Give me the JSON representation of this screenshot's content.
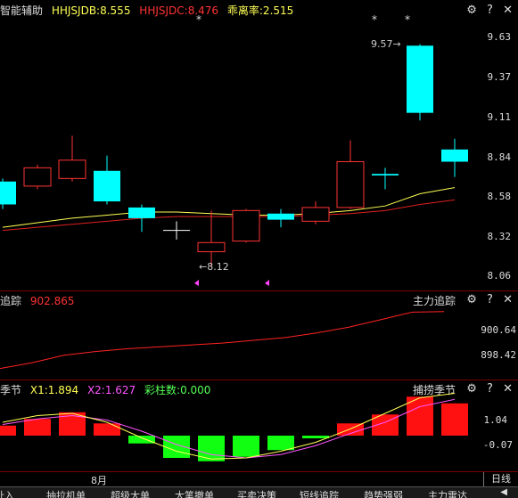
{
  "main_panel": {
    "legend": [
      {
        "text": "智能辅助",
        "color": "#dddddd"
      },
      {
        "text": "HHJSJDB:8.555",
        "color": "#ffff55"
      },
      {
        "text": "HHJSJDC:8.476",
        "color": "#ff3333"
      },
      {
        "text": "乖离率:2.515",
        "color": "#ffff55"
      }
    ],
    "y_labels": [
      "9.63",
      "9.37",
      "9.11",
      "8.84",
      "8.58",
      "8.32",
      "8.06"
    ],
    "high_annotation": "9.57→",
    "low_annotation": "←8.12"
  },
  "middle_panel": {
    "legend": [
      {
        "text": "追踪",
        "color": "#dddddd"
      },
      {
        "text": "902.865",
        "color": "#ff3333"
      }
    ],
    "title": "主力追踪",
    "y_labels": [
      "900.64",
      "898.42"
    ]
  },
  "bottom_panel": {
    "legend": [
      {
        "text": "季节",
        "color": "#dddddd"
      },
      {
        "text": "X1:1.894",
        "color": "#ffff55"
      },
      {
        "text": "X2:1.627",
        "color": "#ff55ff"
      },
      {
        "text": "彩柱数:0.000",
        "color": "#55ff55"
      }
    ],
    "title": "捕捞季节",
    "y_labels": [
      "1.04",
      "-0.07"
    ],
    "x_label": "8月"
  },
  "period_label": "日线",
  "tabs": [
    "扯入",
    "抽拉机单",
    "超级大单",
    "大笔撤单",
    "买卖决策",
    "短线追踪",
    "趋势强弱",
    "主力雷达"
  ],
  "chart_data": {
    "type": "candlestick",
    "ylim": [
      8.06,
      9.63
    ],
    "candles": [
      {
        "open": 8.68,
        "close": 8.53,
        "high": 8.7,
        "low": 8.5
      },
      {
        "open": 8.65,
        "close": 8.77,
        "high": 8.79,
        "low": 8.63
      },
      {
        "open": 8.7,
        "close": 8.82,
        "high": 8.98,
        "low": 8.68
      },
      {
        "open": 8.75,
        "close": 8.55,
        "high": 8.85,
        "low": 8.53
      },
      {
        "open": 8.51,
        "close": 8.44,
        "high": 8.53,
        "low": 8.35
      },
      {
        "open": 8.36,
        "close": 8.36,
        "high": 8.42,
        "low": 8.3
      },
      {
        "open": 8.22,
        "close": 8.28,
        "high": 8.49,
        "low": 8.12
      },
      {
        "open": 8.29,
        "close": 8.49,
        "high": 8.5,
        "low": 8.28
      },
      {
        "open": 8.47,
        "close": 8.43,
        "high": 8.5,
        "low": 8.38
      },
      {
        "open": 8.42,
        "close": 8.51,
        "high": 8.55,
        "low": 8.4
      },
      {
        "open": 8.51,
        "close": 8.81,
        "high": 8.95,
        "low": 8.5
      },
      {
        "open": 8.73,
        "close": 8.72,
        "high": 8.77,
        "low": 8.63
      },
      {
        "open": 9.57,
        "close": 9.13,
        "high": 9.58,
        "low": 9.08
      },
      {
        "open": 8.89,
        "close": 8.81,
        "high": 8.96,
        "low": 8.71
      }
    ],
    "ma_yellow": [
      8.38,
      8.41,
      8.44,
      8.46,
      8.48,
      8.48,
      8.47,
      8.46,
      8.46,
      8.47,
      8.49,
      8.52,
      8.6,
      8.64
    ],
    "ma_red": [
      8.36,
      8.38,
      8.4,
      8.42,
      8.44,
      8.45,
      8.45,
      8.45,
      8.45,
      8.46,
      8.47,
      8.49,
      8.53,
      8.56
    ],
    "markers_top": [
      "*",
      "*",
      "*"
    ],
    "tracking_line": [
      896.8,
      897.4,
      898.2,
      898.6,
      898.9,
      899.1,
      899.3,
      899.5,
      899.8,
      900.1,
      900.6,
      901.2,
      902.0,
      902.8,
      902.865
    ],
    "season_bars": [
      0.45,
      0.75,
      1.05,
      0.55,
      -0.35,
      -1.0,
      -1.15,
      -0.95,
      -0.65,
      -0.12,
      0.55,
      0.95,
      1.75,
      1.45
    ],
    "season_x1": [
      0.6,
      0.9,
      1.0,
      0.6,
      -0.1,
      -0.7,
      -1.05,
      -1.0,
      -0.7,
      -0.3,
      0.3,
      1.0,
      1.7,
      1.9
    ],
    "season_x2": [
      0.5,
      0.75,
      0.9,
      0.7,
      0.2,
      -0.4,
      -0.85,
      -1.0,
      -0.85,
      -0.45,
      0.1,
      0.6,
      1.3,
      1.63
    ],
    "season_ylim": [
      -1.4,
      2.0
    ]
  }
}
